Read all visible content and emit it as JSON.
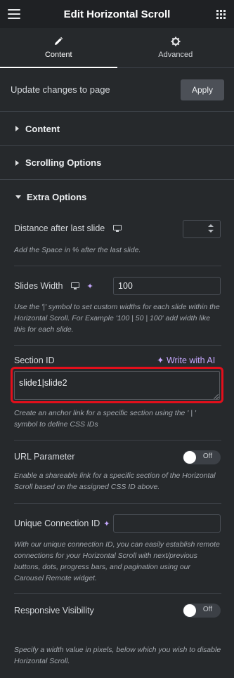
{
  "header": {
    "title": "Edit Horizontal Scroll",
    "menu_icon": "hamburger-icon",
    "apps_icon": "grid-icon"
  },
  "tabs": [
    {
      "label": "Content",
      "icon": "pencil-icon",
      "active": true
    },
    {
      "label": "Advanced",
      "icon": "gear-icon",
      "active": false
    }
  ],
  "update_bar": {
    "text": "Update changes to page",
    "button_label": "Apply"
  },
  "sections": [
    {
      "title": "Content",
      "expanded": false
    },
    {
      "title": "Scrolling Options",
      "expanded": false
    },
    {
      "title": "Extra Options",
      "expanded": true
    }
  ],
  "extra_options": {
    "distance": {
      "label": "Distance after last slide",
      "value": "",
      "description": "Add the Space in % after the last slide."
    },
    "slides_width": {
      "label": "Slides Width",
      "value": "100",
      "description": "Use the '|' symbol to set custom widths for each slide within the Horizontal Scroll. For Example '100 | 50 | 100' add width like this for each slide."
    },
    "section_id": {
      "label": "Section ID",
      "ai_label": "Write with AI",
      "value": "slide1|slide2",
      "description": "Create an anchor link for a specific section using the ' | ' symbol to define CSS IDs"
    },
    "url_parameter": {
      "label": "URL Parameter",
      "toggle_label": "Off",
      "on": false,
      "description": "Enable a shareable link for a specific section of the Horizontal Scroll based on the assigned CSS ID above."
    },
    "unique_connection": {
      "label": "Unique Connection ID",
      "value": "",
      "description": "With our unique connection ID, you can easily establish remote connections for your Horizontal Scroll with next/previous buttons, dots, progress bars, and pagination using our Carousel Remote widget."
    },
    "responsive_visibility": {
      "label": "Responsive Visibility",
      "toggle_label": "Off",
      "on": false,
      "description": "Specify a width value in pixels, below which you wish to disable Horizontal Scroll."
    }
  },
  "colors": {
    "panel_bg": "#26292c",
    "header_bg": "#1f2124",
    "accent_ai": "#c6a8ff",
    "highlight_border": "#e20f1b"
  }
}
